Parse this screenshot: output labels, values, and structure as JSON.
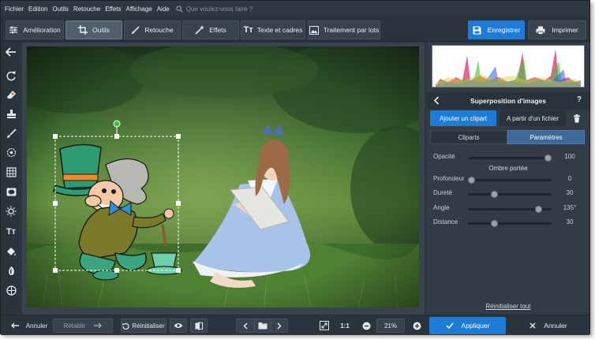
{
  "menu": {
    "items": [
      "Fichier",
      "Edition",
      "Outils",
      "Retouche",
      "Effets",
      "Affichage",
      "Aide"
    ],
    "search_placeholder": "Que voulez-vous faire ?"
  },
  "toolbar": {
    "tabs": [
      {
        "label": "Amélioration",
        "icon": "sliders-icon"
      },
      {
        "label": "Outils",
        "icon": "crop-icon"
      },
      {
        "label": "Retouche",
        "icon": "brush-icon"
      },
      {
        "label": "Effets",
        "icon": "magic-wand-icon"
      },
      {
        "label": "Texte et cadres",
        "icon": "text-icon"
      },
      {
        "label": "Traitement par lots",
        "icon": "images-icon"
      }
    ],
    "active_tab": "Outils",
    "save_label": "Enregistrer",
    "print_label": "Imprimer"
  },
  "left_tools": [
    "back-arrow-icon",
    "rotate-icon",
    "eraser-icon",
    "stamp-icon",
    "brush-icon",
    "target-icon",
    "grid-icon",
    "vignette-icon",
    "sun-icon",
    "text-icon",
    "bucket-icon",
    "gradient-icon",
    "globe-icon"
  ],
  "panel": {
    "title": "Superposition d'images",
    "help": "?",
    "add_clipart": "Ajouter un clipart",
    "from_file": "A partir d'un fichier",
    "subtabs": [
      "Cliparts",
      "Paramètres"
    ],
    "active_subtab": "Paramètres",
    "opacity": {
      "label": "Opacité",
      "value": "100",
      "level": 1.0
    },
    "shadow_title": "Ombre portée",
    "shadow": [
      {
        "label": "Profondeur",
        "value": "0",
        "level": 0.0
      },
      {
        "label": "Dureté",
        "value": "30",
        "level": 0.3
      },
      {
        "label": "Angle",
        "value": "135°",
        "level": 0.88
      },
      {
        "label": "Distance",
        "value": "30",
        "level": 0.3
      }
    ],
    "reset_all": "Réinitialiser tout"
  },
  "bottom": {
    "undo": "Annuler",
    "redo": "Rétablir",
    "reset": "Réinitialiser",
    "ratio": "1:1",
    "zoom": "21%",
    "apply": "Appliquer",
    "cancel": "Annuler"
  },
  "colors": {
    "accent": "#1e7bd6",
    "panel_bg": "#333c46",
    "window_bg": "#2d3640",
    "active_subtab": "#3d6a99"
  }
}
